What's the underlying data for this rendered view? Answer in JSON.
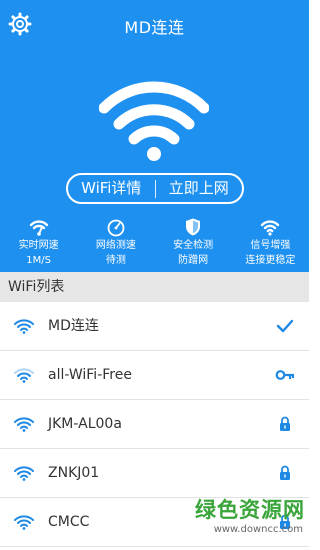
{
  "app": {
    "title": "MD连连"
  },
  "actions": {
    "details": "WiFi详情",
    "connect": "立即上网"
  },
  "features": [
    {
      "label": "实时网速",
      "sub": "1M/S",
      "icon": "wifi-speed-icon"
    },
    {
      "label": "网络测速",
      "sub": "待测",
      "icon": "speedometer-icon"
    },
    {
      "label": "安全检测",
      "sub": "防蹭网",
      "icon": "shield-icon"
    },
    {
      "label": "信号增强",
      "sub": "连接更稳定",
      "icon": "wifi-boost-icon"
    }
  ],
  "list": {
    "header": "WiFi列表",
    "items": [
      {
        "ssid": "MD连连",
        "status": "connected",
        "icon": "check-icon"
      },
      {
        "ssid": "all-WiFi-Free",
        "status": "key",
        "icon": "key-icon"
      },
      {
        "ssid": "JKM-AL00a",
        "status": "locked",
        "icon": "lock-icon"
      },
      {
        "ssid": "ZNKJ01",
        "status": "locked",
        "icon": "lock-icon"
      },
      {
        "ssid": "CMCC",
        "status": "locked",
        "icon": "lock-icon"
      }
    ]
  },
  "watermark": {
    "text": "绿色资源网",
    "url": "www.downcc.com"
  },
  "colors": {
    "primary": "#1e90f0",
    "accent": "#1e88e5",
    "list_header_bg": "#e6e6e6"
  }
}
